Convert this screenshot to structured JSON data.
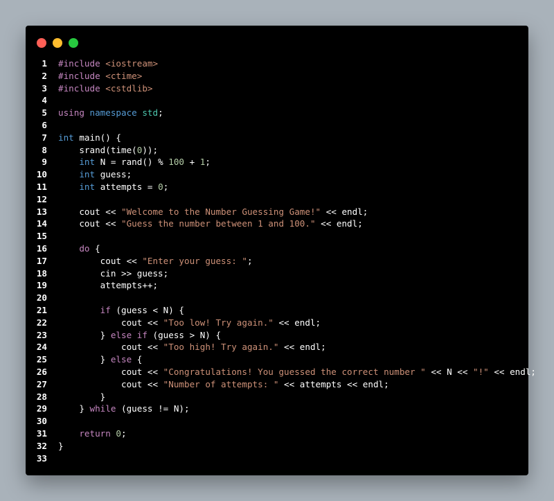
{
  "window": {
    "controls": [
      {
        "name": "close",
        "color": "#ff5f56"
      },
      {
        "name": "minimize",
        "color": "#ffbd2e"
      },
      {
        "name": "maximize",
        "color": "#27c93f"
      }
    ]
  },
  "colors": {
    "background": "#a9b2ba",
    "editor_bg": "#000000",
    "keyword": "#c586c0",
    "type": "#569cd6",
    "namespace": "#4ec9b0",
    "string": "#ce9178",
    "number": "#b5cea8",
    "plain": "#ffffff"
  },
  "code": {
    "language": "cpp",
    "lines": [
      {
        "n": "1",
        "tokens": [
          {
            "t": "#include ",
            "c": "kw"
          },
          {
            "t": "<iostream>",
            "c": "str"
          }
        ]
      },
      {
        "n": "2",
        "tokens": [
          {
            "t": "#include ",
            "c": "kw"
          },
          {
            "t": "<ctime>",
            "c": "str"
          }
        ]
      },
      {
        "n": "3",
        "tokens": [
          {
            "t": "#include ",
            "c": "kw"
          },
          {
            "t": "<cstdlib>",
            "c": "str"
          }
        ]
      },
      {
        "n": "4",
        "tokens": []
      },
      {
        "n": "5",
        "tokens": [
          {
            "t": "using ",
            "c": "kw"
          },
          {
            "t": "namespace ",
            "c": "type"
          },
          {
            "t": "std",
            "c": "ns"
          },
          {
            "t": ";",
            "c": "plain"
          }
        ]
      },
      {
        "n": "6",
        "tokens": []
      },
      {
        "n": "7",
        "tokens": [
          {
            "t": "int ",
            "c": "type"
          },
          {
            "t": "main() {",
            "c": "plain"
          }
        ]
      },
      {
        "n": "8",
        "tokens": [
          {
            "t": "    srand(time(",
            "c": "plain"
          },
          {
            "t": "0",
            "c": "num"
          },
          {
            "t": "));",
            "c": "plain"
          }
        ]
      },
      {
        "n": "9",
        "tokens": [
          {
            "t": "    ",
            "c": "plain"
          },
          {
            "t": "int ",
            "c": "type"
          },
          {
            "t": "N = rand() % ",
            "c": "plain"
          },
          {
            "t": "100",
            "c": "num"
          },
          {
            "t": " + ",
            "c": "plain"
          },
          {
            "t": "1",
            "c": "num"
          },
          {
            "t": ";",
            "c": "plain"
          }
        ]
      },
      {
        "n": "10",
        "tokens": [
          {
            "t": "    ",
            "c": "plain"
          },
          {
            "t": "int ",
            "c": "type"
          },
          {
            "t": "guess;",
            "c": "plain"
          }
        ]
      },
      {
        "n": "11",
        "tokens": [
          {
            "t": "    ",
            "c": "plain"
          },
          {
            "t": "int ",
            "c": "type"
          },
          {
            "t": "attempts = ",
            "c": "plain"
          },
          {
            "t": "0",
            "c": "num"
          },
          {
            "t": ";",
            "c": "plain"
          }
        ]
      },
      {
        "n": "12",
        "tokens": []
      },
      {
        "n": "13",
        "tokens": [
          {
            "t": "    cout << ",
            "c": "plain"
          },
          {
            "t": "\"Welcome to the Number Guessing Game!\"",
            "c": "str"
          },
          {
            "t": " << endl;",
            "c": "plain"
          }
        ]
      },
      {
        "n": "14",
        "tokens": [
          {
            "t": "    cout << ",
            "c": "plain"
          },
          {
            "t": "\"Guess the number between 1 and 100.\"",
            "c": "str"
          },
          {
            "t": " << endl;",
            "c": "plain"
          }
        ]
      },
      {
        "n": "15",
        "tokens": []
      },
      {
        "n": "16",
        "tokens": [
          {
            "t": "    ",
            "c": "plain"
          },
          {
            "t": "do",
            "c": "kw"
          },
          {
            "t": " {",
            "c": "plain"
          }
        ]
      },
      {
        "n": "17",
        "tokens": [
          {
            "t": "        cout << ",
            "c": "plain"
          },
          {
            "t": "\"Enter your guess: \"",
            "c": "str"
          },
          {
            "t": ";",
            "c": "plain"
          }
        ]
      },
      {
        "n": "18",
        "tokens": [
          {
            "t": "        cin >> guess;",
            "c": "plain"
          }
        ]
      },
      {
        "n": "19",
        "tokens": [
          {
            "t": "        attempts++;",
            "c": "plain"
          }
        ]
      },
      {
        "n": "20",
        "tokens": []
      },
      {
        "n": "21",
        "tokens": [
          {
            "t": "        ",
            "c": "plain"
          },
          {
            "t": "if",
            "c": "kw"
          },
          {
            "t": " (guess < N) {",
            "c": "plain"
          }
        ]
      },
      {
        "n": "22",
        "tokens": [
          {
            "t": "            cout << ",
            "c": "plain"
          },
          {
            "t": "\"Too low! Try again.\"",
            "c": "str"
          },
          {
            "t": " << endl;",
            "c": "plain"
          }
        ]
      },
      {
        "n": "23",
        "tokens": [
          {
            "t": "        } ",
            "c": "plain"
          },
          {
            "t": "else if",
            "c": "kw"
          },
          {
            "t": " (guess > N) {",
            "c": "plain"
          }
        ]
      },
      {
        "n": "24",
        "tokens": [
          {
            "t": "            cout << ",
            "c": "plain"
          },
          {
            "t": "\"Too high! Try again.\"",
            "c": "str"
          },
          {
            "t": " << endl;",
            "c": "plain"
          }
        ]
      },
      {
        "n": "25",
        "tokens": [
          {
            "t": "        } ",
            "c": "plain"
          },
          {
            "t": "else",
            "c": "kw"
          },
          {
            "t": " {",
            "c": "plain"
          }
        ]
      },
      {
        "n": "26",
        "tokens": [
          {
            "t": "            cout << ",
            "c": "plain"
          },
          {
            "t": "\"Congratulations! You guessed the correct number \"",
            "c": "str"
          },
          {
            "t": " << N << ",
            "c": "plain"
          },
          {
            "t": "\"!\"",
            "c": "str"
          },
          {
            "t": " << endl;",
            "c": "plain"
          }
        ]
      },
      {
        "n": "27",
        "tokens": [
          {
            "t": "            cout << ",
            "c": "plain"
          },
          {
            "t": "\"Number of attempts: \"",
            "c": "str"
          },
          {
            "t": " << attempts << endl;",
            "c": "plain"
          }
        ]
      },
      {
        "n": "28",
        "tokens": [
          {
            "t": "        }",
            "c": "plain"
          }
        ]
      },
      {
        "n": "29",
        "tokens": [
          {
            "t": "    } ",
            "c": "plain"
          },
          {
            "t": "while",
            "c": "kw"
          },
          {
            "t": " (guess != N);",
            "c": "plain"
          }
        ]
      },
      {
        "n": "30",
        "tokens": []
      },
      {
        "n": "31",
        "tokens": [
          {
            "t": "    ",
            "c": "plain"
          },
          {
            "t": "return ",
            "c": "kw"
          },
          {
            "t": "0",
            "c": "num"
          },
          {
            "t": ";",
            "c": "plain"
          }
        ]
      },
      {
        "n": "32",
        "tokens": [
          {
            "t": "}",
            "c": "plain"
          }
        ]
      },
      {
        "n": "33",
        "tokens": []
      }
    ]
  }
}
